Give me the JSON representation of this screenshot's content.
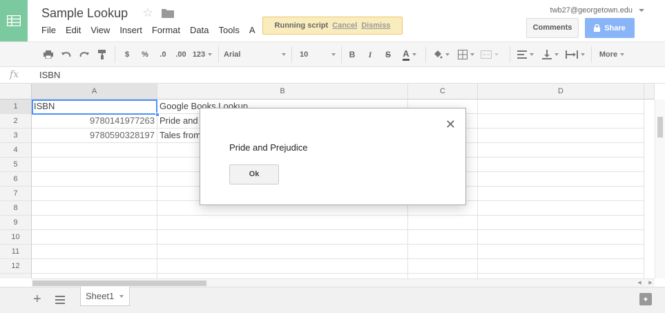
{
  "header": {
    "title": "Sample Lookup",
    "user_email": "twb27@georgetown.edu",
    "comments_label": "Comments",
    "share_label": "Share",
    "menu": [
      "File",
      "Edit",
      "View",
      "Insert",
      "Format",
      "Data",
      "Tools",
      "A"
    ]
  },
  "running_script": {
    "text": "Running script",
    "cancel": "Cancel",
    "dismiss": "Dismiss"
  },
  "toolbar": {
    "currency": "$",
    "percent": "%",
    "decimal_less": ".0",
    "decimal_more": ".00",
    "number_format": "123",
    "font": "Arial",
    "font_size": "10",
    "bold": "B",
    "italic": "I",
    "strike": "S",
    "text_color": "A",
    "more": "More"
  },
  "formula_bar": {
    "fx": "fx",
    "value": "ISBN"
  },
  "grid": {
    "columns": [
      "A",
      "B",
      "C",
      "D"
    ],
    "rows": [
      "1",
      "2",
      "3",
      "4",
      "5",
      "6",
      "7",
      "8",
      "9",
      "10",
      "11",
      "12"
    ],
    "cells": {
      "a1": "ISBN",
      "b1": "Google Books Lookup",
      "a2": "9780141977263",
      "b2": "Pride and",
      "a3": "9780590328197",
      "b3": "Tales from"
    }
  },
  "sheets": {
    "tab": "Sheet1"
  },
  "dialog": {
    "message": "Pride and Prejudice",
    "ok_label": "Ok"
  },
  "colors": {
    "logo": "#7bc99f",
    "share": "#8ab4f8",
    "selection": "#4d90fe",
    "running_bar": "#f9edbe"
  }
}
